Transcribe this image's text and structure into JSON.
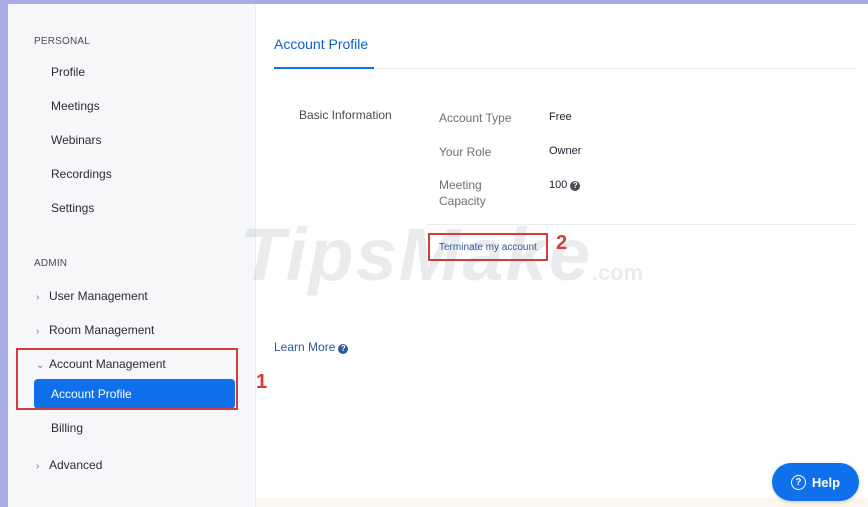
{
  "sidebar": {
    "personal_label": "PERSONAL",
    "personal_items": [
      "Profile",
      "Meetings",
      "Webinars",
      "Recordings",
      "Settings"
    ],
    "admin_label": "ADMIN",
    "user_management": "User Management",
    "room_management": "Room Management",
    "account_management": "Account Management",
    "account_profile": "Account Profile",
    "billing": "Billing",
    "advanced": "Advanced"
  },
  "main": {
    "tab_title": "Account Profile",
    "section_title": "Basic Information",
    "fields": {
      "account_type_label": "Account Type",
      "account_type_value": "Free",
      "your_role_label": "Your Role",
      "your_role_value": "Owner",
      "meeting_capacity_label_1": "Meeting",
      "meeting_capacity_label_2": "Capacity",
      "meeting_capacity_value": "100"
    },
    "terminate_link": "Terminate my account",
    "learn_more": "Learn More"
  },
  "annotations": {
    "callout_1": "1",
    "callout_2": "2"
  },
  "watermark": {
    "text": "TipsMake",
    "suffix": ".com"
  },
  "help_button": "Help",
  "colors": {
    "accent": "#0e71eb",
    "callout": "#d63a3a",
    "link": "#2d5a9c"
  },
  "icons": [
    "chevron-right-icon",
    "chevron-down-icon",
    "info-icon",
    "question-circle-icon"
  ]
}
